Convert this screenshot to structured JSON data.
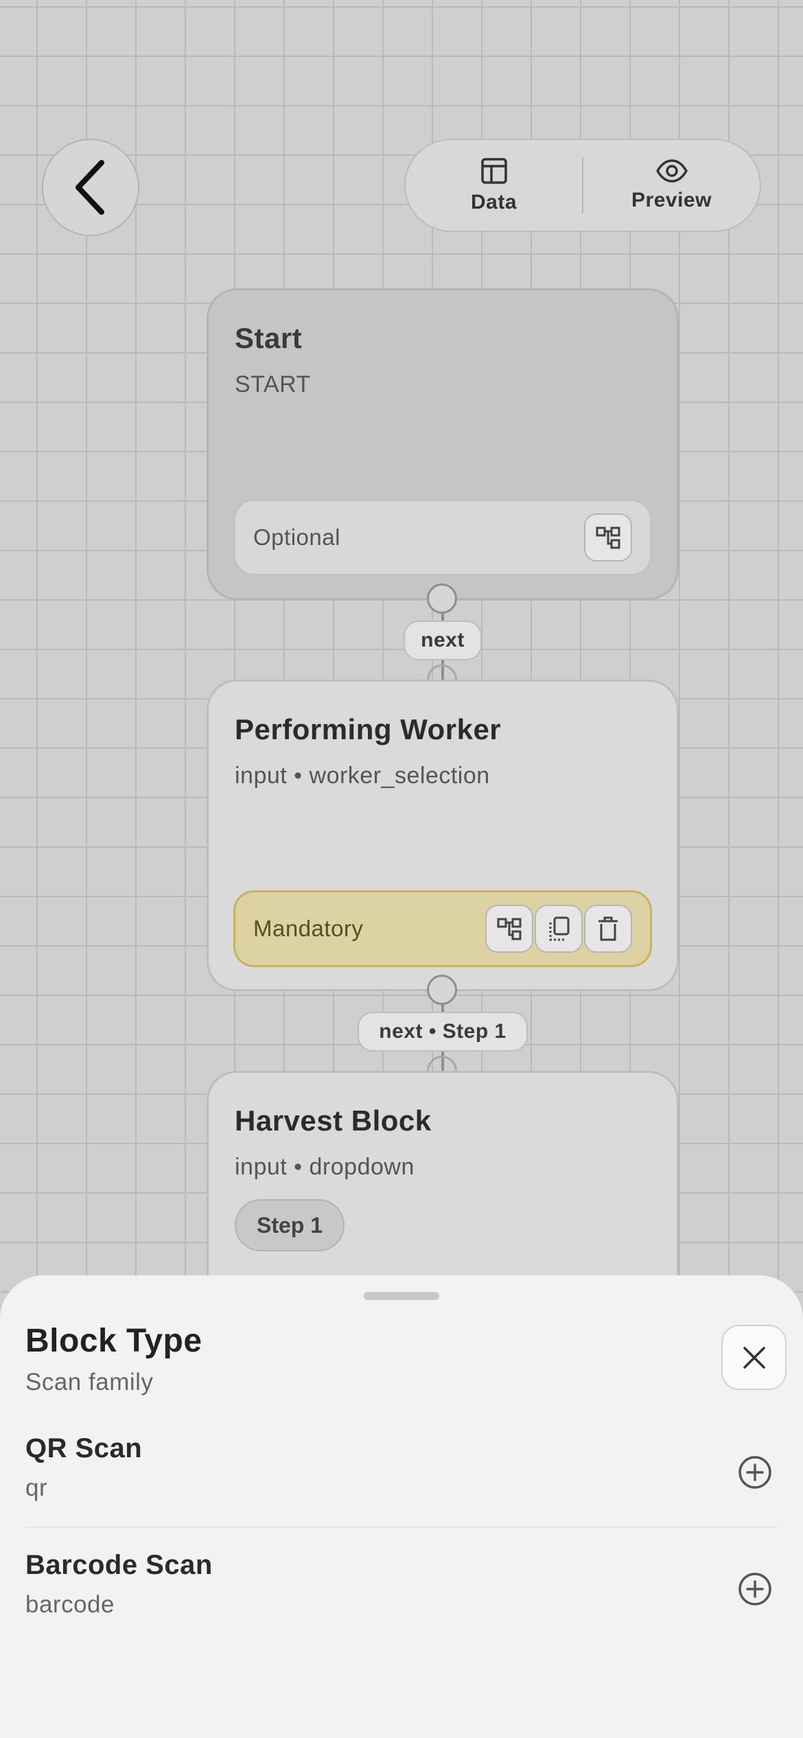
{
  "toolbar": {
    "data_label": "Data",
    "preview_label": "Preview"
  },
  "flow": {
    "start": {
      "title": "Start",
      "subtitle": "START",
      "footer": "Optional"
    },
    "edge1": "next",
    "worker": {
      "title": "Performing Worker",
      "subtitle": "input • worker_selection",
      "footer": "Mandatory"
    },
    "edge2": "next • Step 1",
    "harvest": {
      "title": "Harvest Block",
      "subtitle": "input • dropdown",
      "chip": "Step 1"
    }
  },
  "sheet": {
    "title": "Block Type",
    "subtitle": "Scan family",
    "options": [
      {
        "name": "QR Scan",
        "key": "qr"
      },
      {
        "name": "Barcode Scan",
        "key": "barcode"
      }
    ]
  },
  "colors": {
    "canvas": "#cfcfcf",
    "mandatory": "#dcd2a3",
    "sheet": "#f2f2f2"
  },
  "icons": [
    "chevron-left-icon",
    "table-icon",
    "eye-icon",
    "branch-icon",
    "duplicate-icon",
    "trash-icon",
    "close-icon",
    "plus-circle-icon"
  ]
}
